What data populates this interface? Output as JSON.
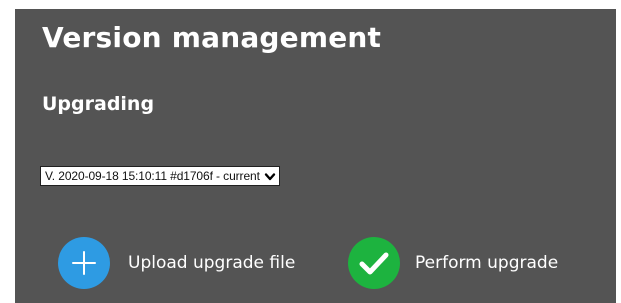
{
  "header": {
    "title": "Version management"
  },
  "upgrading": {
    "heading": "Upgrading",
    "version_select": {
      "selected": "V. 2020-09-18 15:10:11 #d1706f - current"
    },
    "actions": {
      "upload": {
        "label": "Upload upgrade file",
        "icon": "plus-icon",
        "color": "#2e9be3"
      },
      "perform": {
        "label": "Perform upgrade",
        "icon": "checkmark-icon",
        "color": "#1db33f"
      }
    }
  }
}
